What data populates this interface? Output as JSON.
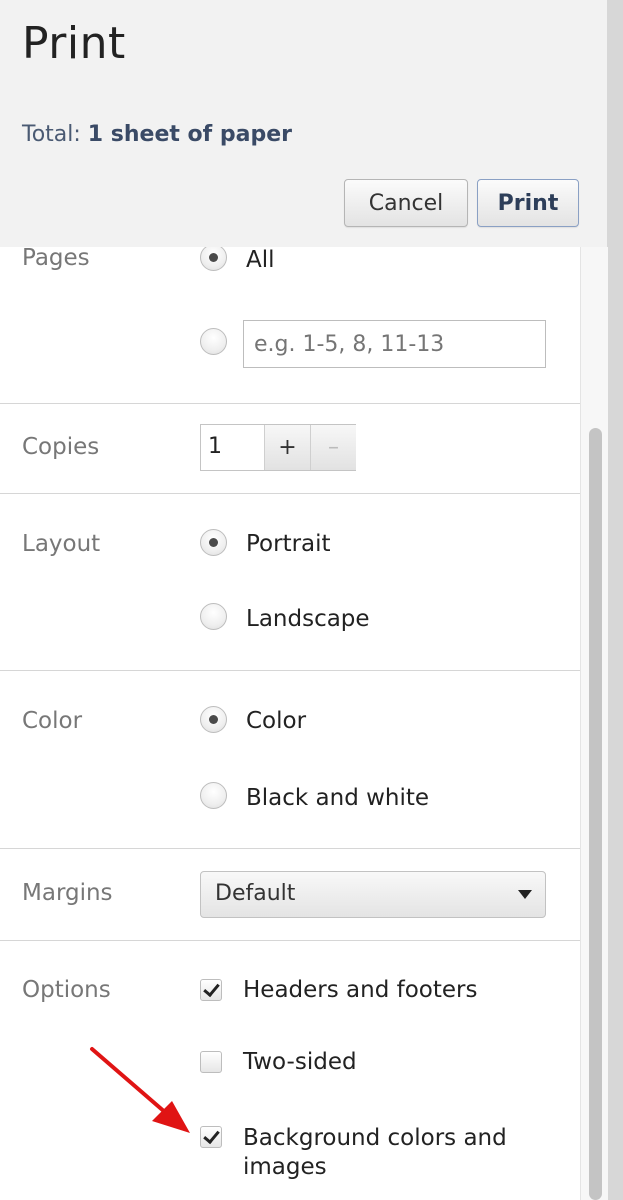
{
  "header": {
    "title": "Print",
    "total_label": "Total:",
    "total_value": "1 sheet of paper",
    "cancel_label": "Cancel",
    "print_label": "Print"
  },
  "pages": {
    "label": "Pages",
    "option_all": "All",
    "range_placeholder": "e.g. 1-5, 8, 11-13",
    "selected": "All"
  },
  "copies": {
    "label": "Copies",
    "value": "1",
    "plus": "+",
    "minus": "–"
  },
  "layout": {
    "label": "Layout",
    "options": [
      "Portrait",
      "Landscape"
    ],
    "selected": "Portrait"
  },
  "color": {
    "label": "Color",
    "options": [
      "Color",
      "Black and white"
    ],
    "selected": "Color"
  },
  "margins": {
    "label": "Margins",
    "value": "Default"
  },
  "options": {
    "label": "Options",
    "items": [
      {
        "label": "Headers and footers",
        "checked": true
      },
      {
        "label": "Two-sided",
        "checked": false
      },
      {
        "label": "Background colors and images",
        "checked": true
      }
    ]
  },
  "colors": {
    "annotation_arrow": "#e01414",
    "header_bg": "#f2f2f2"
  }
}
